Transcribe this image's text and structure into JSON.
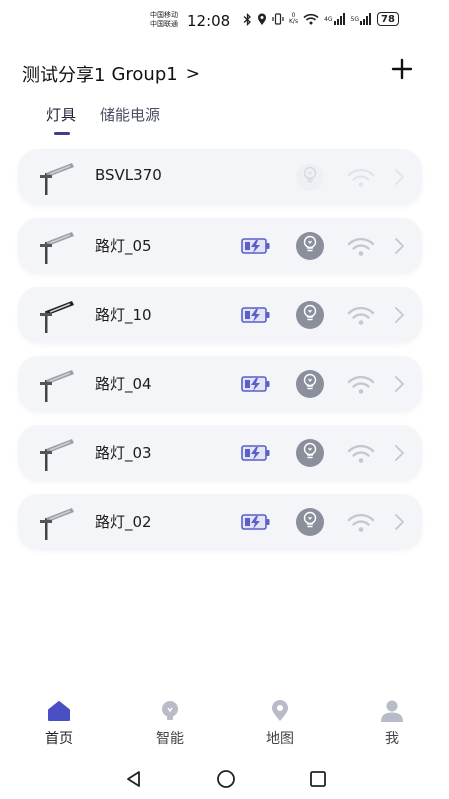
{
  "status_bar": {
    "carrier_1": "中国移动",
    "carrier_2": "中国联通",
    "time": "12:08",
    "net_speed_value": "0",
    "net_speed_unit": "K/s",
    "signal_1_label": "4G",
    "signal_2_label": "5G",
    "battery": "78"
  },
  "header": {
    "share_name": "测试分享1",
    "group_name": "Group1",
    "chevron": ">",
    "add_icon": "plus-icon"
  },
  "tabs": [
    {
      "label": "灯具",
      "active": true
    },
    {
      "label": "储能电源",
      "active": false
    }
  ],
  "devices": [
    {
      "name": "BSVL370",
      "faded": true
    },
    {
      "name": "路灯_05",
      "faded": false
    },
    {
      "name": "路灯_10",
      "faded": false
    },
    {
      "name": "路灯_04",
      "faded": false
    },
    {
      "name": "路灯_03",
      "faded": false
    },
    {
      "name": "路灯_02",
      "faded": false
    }
  ],
  "bottom_nav": [
    {
      "label": "首页",
      "icon": "home-icon",
      "active": true
    },
    {
      "label": "智能",
      "icon": "bulb-icon",
      "active": false
    },
    {
      "label": "地图",
      "icon": "map-pin-icon",
      "active": false
    },
    {
      "label": "我",
      "icon": "user-icon",
      "active": false
    }
  ],
  "colors": {
    "accent": "#3c3f8f",
    "nav_active": "#4a4fc4",
    "nav_inactive": "#b8bcc7",
    "battery_icon": "#5b5fc7",
    "bulb_bg": "#8b8f9c",
    "wifi": "#c3c7d0",
    "card_bg": "#f4f5f8"
  }
}
